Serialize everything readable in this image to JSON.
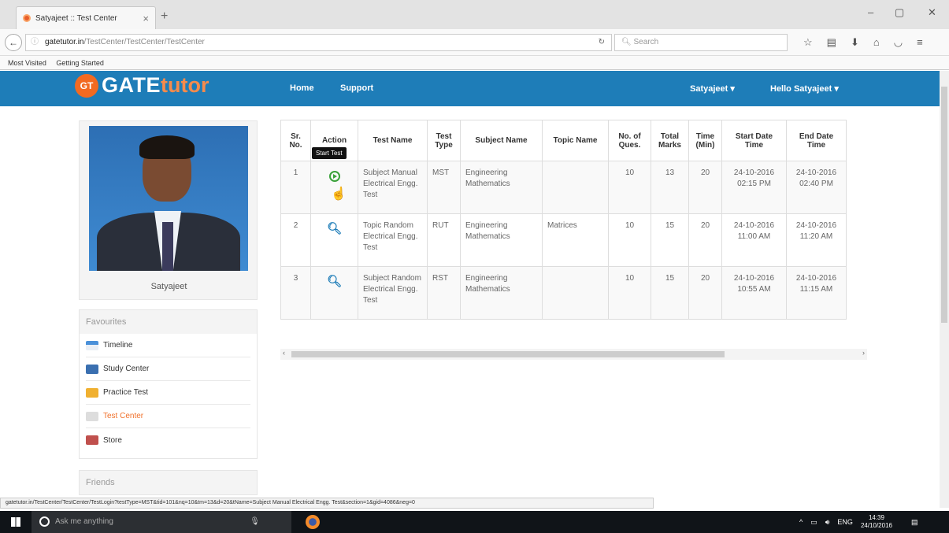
{
  "browser": {
    "tab_title": "Satyajeet :: Test Center",
    "url_domain": "gatetutor.in",
    "url_path": "/TestCenter/TestCenter/TestCenter",
    "search_placeholder": "Search",
    "bookmarks": [
      "Most Visited",
      "Getting Started"
    ]
  },
  "header": {
    "logo_badge": "GT",
    "logo_gate": "GATE",
    "logo_tutor": "tutor",
    "nav": [
      "Home",
      "Support"
    ],
    "user_menu": "Satyajeet ▾",
    "greeting_menu": "Hello Satyajeet ▾"
  },
  "profile": {
    "name": "Satyajeet"
  },
  "favourites": {
    "title": "Favourites",
    "items": [
      "Timeline",
      "Study Center",
      "Practice Test",
      "Test Center",
      "Store"
    ]
  },
  "friends": {
    "title": "Friends"
  },
  "table": {
    "headers": [
      "Sr. No.",
      "Action",
      "Test Name",
      "Test Type",
      "Subject Name",
      "Topic Name",
      "No. of Ques.",
      "Total Marks",
      "Time (Min)",
      "Start Date Time",
      "End Date Time"
    ],
    "rows": [
      {
        "sr": "1",
        "action": "start",
        "test_name": "Subject Manual Electrical Engg. Test",
        "type": "MST",
        "subject": "Engineering Mathematics",
        "topic": "",
        "ques": "10",
        "marks": "13",
        "time": "20",
        "start": "24-10-2016 02:15 PM",
        "end": "24-10-2016 02:40 PM"
      },
      {
        "sr": "2",
        "action": "view",
        "test_name": "Topic Random Electrical Engg. Test",
        "type": "RUT",
        "subject": "Engineering Mathematics",
        "topic": "Matrices",
        "ques": "10",
        "marks": "15",
        "time": "20",
        "start": "24-10-2016 11:00 AM",
        "end": "24-10-2016 11:20 AM"
      },
      {
        "sr": "3",
        "action": "view",
        "test_name": "Subject Random Electrical Engg. Test",
        "type": "RST",
        "subject": "Engineering Mathematics",
        "topic": "",
        "ques": "10",
        "marks": "15",
        "time": "20",
        "start": "24-10-2016 10:55 AM",
        "end": "24-10-2016 11:15 AM"
      }
    ]
  },
  "tooltip": "Start Test",
  "status_url": "gatetutor.in/TestCenter/TestCenter/TestLogin?testType=MST&tid=101&nq=10&tm=13&d=20&tName=Subject Manual Electrical Engg. Test&section=1&gid=4086&neg=0",
  "taskbar": {
    "search_placeholder": "Ask me anything",
    "lang": "ENG",
    "time": "14:39",
    "date": "24/10/2016"
  },
  "colors": {
    "brand_blue": "#1e7db8",
    "brand_orange": "#f26a21",
    "active_link": "#f0702a"
  }
}
